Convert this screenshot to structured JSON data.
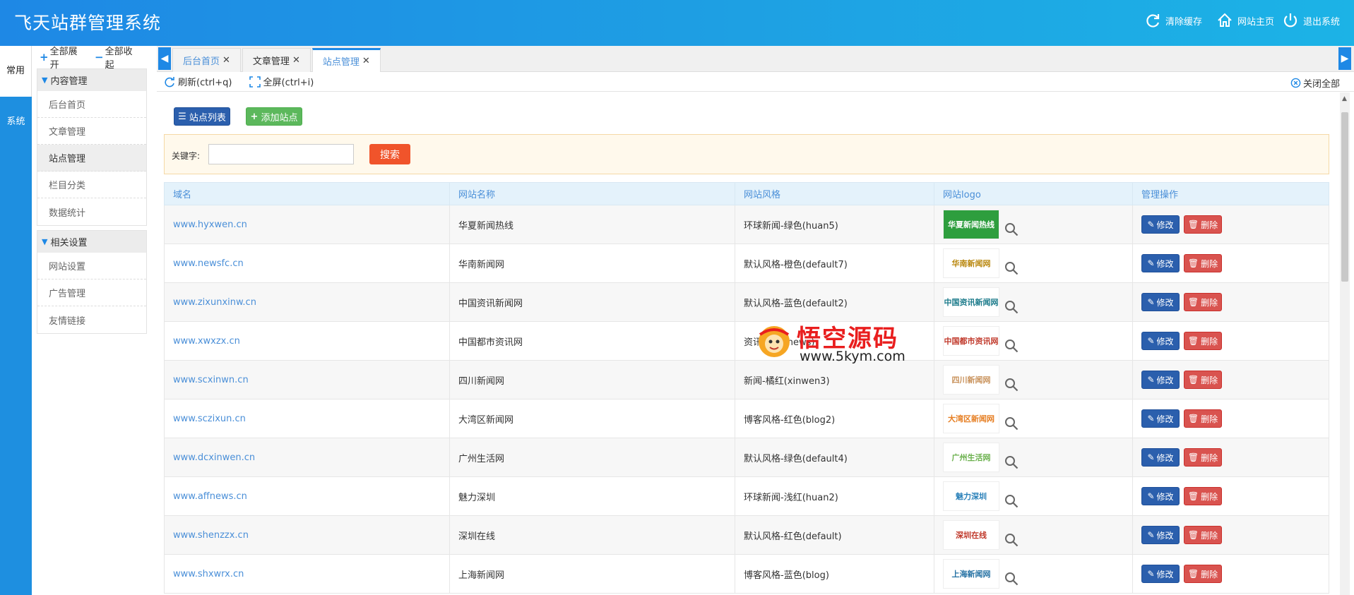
{
  "header": {
    "title": "飞天站群管理系统",
    "clear_cache": "清除缓存",
    "site_home": "网站主页",
    "logout": "退出系统"
  },
  "side_tabs": [
    "常用",
    "系统"
  ],
  "menu": {
    "expand_all": "全部展开",
    "collapse_all": "全部收起",
    "groups": [
      {
        "title": "内容管理",
        "items": [
          "后台首页",
          "文章管理",
          "站点管理",
          "栏目分类",
          "数据统计"
        ]
      },
      {
        "title": "相关设置",
        "items": [
          "网站设置",
          "广告管理",
          "友情链接"
        ]
      }
    ]
  },
  "tabs": [
    {
      "label": "后台首页"
    },
    {
      "label": "文章管理"
    },
    {
      "label": "站点管理"
    }
  ],
  "toolbar": {
    "refresh": "刷新(ctrl+q)",
    "fullscreen": "全屏(ctrl+i)",
    "close_all": "关闭全部"
  },
  "actions": {
    "site_list": "站点列表",
    "add_site": "添加站点"
  },
  "search": {
    "label": "关键字:",
    "value": "",
    "button": "搜索"
  },
  "table": {
    "columns": [
      "域名",
      "网站名称",
      "网站风格",
      "网站logo",
      "管理操作"
    ],
    "rows": [
      {
        "domain": "www.hyxwen.cn",
        "name": "华夏新闻热线",
        "style": "环球新闻-绿色(huan5)",
        "logo": "华夏新闻热线"
      },
      {
        "domain": "www.newsfc.cn",
        "name": "华南新闻网",
        "style": "默认风格-橙色(default7)",
        "logo": "华南新闻网"
      },
      {
        "domain": "www.zixunxinw.cn",
        "name": "中国资讯新闻网",
        "style": "默认风格-蓝色(default2)",
        "logo": "中国资讯新闻网"
      },
      {
        "domain": "www.xwxzx.cn",
        "name": "中国都市资讯网",
        "style": "资讯-深红(news)",
        "logo": "中国都市资讯网"
      },
      {
        "domain": "www.scxinwn.cn",
        "name": "四川新闻网",
        "style": "新闻-橘红(xinwen3)",
        "logo": "四川新闻网"
      },
      {
        "domain": "www.sczixun.cn",
        "name": "大湾区新闻网",
        "style": "博客风格-红色(blog2)",
        "logo": "大湾区新闻网"
      },
      {
        "domain": "www.dcxinwen.cn",
        "name": "广州生活网",
        "style": "默认风格-绿色(default4)",
        "logo": "广州生活网"
      },
      {
        "domain": "www.affnews.cn",
        "name": "魅力深圳",
        "style": "环球新闻-浅红(huan2)",
        "logo": "魅力深圳"
      },
      {
        "domain": "www.shenzzx.cn",
        "name": "深圳在线",
        "style": "默认风格-红色(default)",
        "logo": "深圳在线"
      },
      {
        "domain": "www.shxwrx.cn",
        "name": "上海新闻网",
        "style": "博客风格-蓝色(blog)",
        "logo": "上海新闻网"
      }
    ],
    "edit_label": "修改",
    "delete_label": "删除"
  },
  "watermark": {
    "title": "悟空源码",
    "url": "www.5kym.com"
  },
  "colors": {
    "header_start": "#1e88e5",
    "header_end": "#1cb3e6",
    "primary": "#2b5fad",
    "danger": "#d9534f",
    "search": "#f0542b",
    "success": "#5cb85c",
    "link": "#4a8fd8"
  },
  "icons": {
    "clear_cache": "refresh-icon",
    "site_home": "home-icon",
    "logout": "power-icon",
    "refresh": "refresh-icon",
    "fullscreen": "fullscreen-icon",
    "close_all": "close-circle-icon",
    "search_logo": "magnifier-icon",
    "edit": "pencil-icon",
    "delete": "trash-icon"
  }
}
